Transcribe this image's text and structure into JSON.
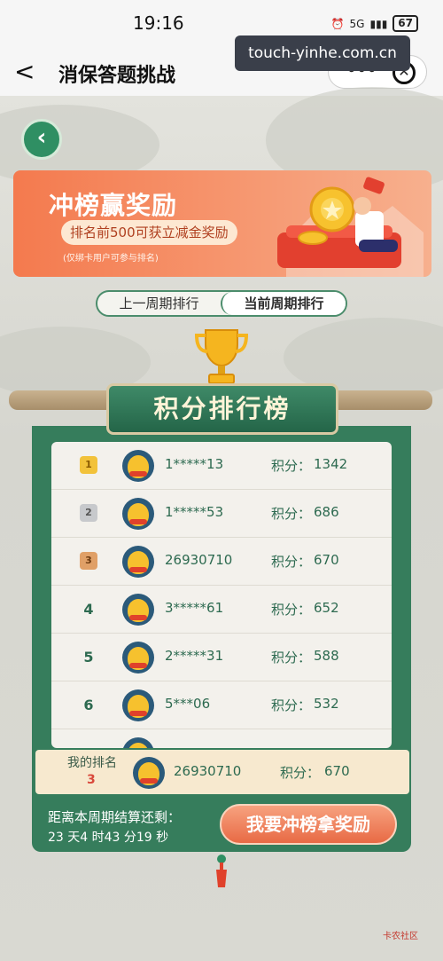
{
  "status_bar": {
    "time": "19:16",
    "network": "5G",
    "battery": "67"
  },
  "nav": {
    "back_glyph": "<",
    "title": "消保答题挑战",
    "more_glyph": "•••",
    "close_glyph": "✕"
  },
  "watermark": {
    "url": "touch-yinhe.com.cn"
  },
  "banner": {
    "title": "冲榜赢奖励",
    "subtitle": "排名前500可获立减金奖励",
    "note": "(仅绑卡用户可参与排名)"
  },
  "tabs": [
    {
      "label": "上一周期排行",
      "active": false
    },
    {
      "label": "当前周期排行",
      "active": true
    }
  ],
  "board_title": "积分排行榜",
  "score_label": "积分：",
  "leaderboard": [
    {
      "rank": "1",
      "medal": "gold",
      "name": "1*****13",
      "score": "1342"
    },
    {
      "rank": "2",
      "medal": "silver",
      "name": "1*****53",
      "score": "686"
    },
    {
      "rank": "3",
      "medal": "bronze",
      "name": "26930710",
      "score": "670"
    },
    {
      "rank": "4",
      "medal": "",
      "name": "3*****61",
      "score": "652"
    },
    {
      "rank": "5",
      "medal": "",
      "name": "2*****31",
      "score": "588"
    },
    {
      "rank": "6",
      "medal": "",
      "name": "5***06",
      "score": "532"
    }
  ],
  "my_rank": {
    "label": "我的排名",
    "rank": "3",
    "name": "26930710",
    "score": "670"
  },
  "countdown": {
    "label": "距离本周期结算还剩：",
    "value": "23 天4 时43 分19 秒"
  },
  "cta_label": "我要冲榜拿奖励",
  "corner_logo": "卡农社区",
  "colors": {
    "primary_green": "#367d5c",
    "banner_orange": "#f47a4e",
    "cta_orange": "#e86a45",
    "medal_gold": "#f2c23a"
  }
}
